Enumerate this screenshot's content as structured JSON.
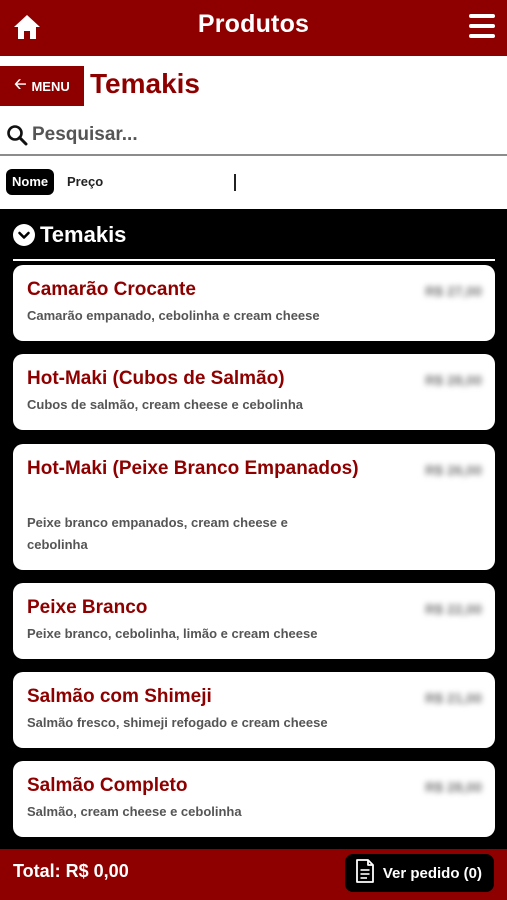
{
  "header": {
    "title": "Produtos",
    "home_icon": "home-icon",
    "menu_icon": "hamburger-menu-icon"
  },
  "nav": {
    "back_label": "MENU",
    "back_icon": "arrow-left-icon",
    "category_title": "Temakis"
  },
  "search": {
    "placeholder": "Pesquisar...",
    "value": ""
  },
  "sort": {
    "active": "Nome",
    "other": "Preço"
  },
  "section": {
    "title": "Temakis",
    "icon": "chevron-down-circle-icon"
  },
  "products": [
    {
      "name": "Camarão Crocante",
      "description": "Camarão empanado, cebolinha e cream cheese",
      "price": "R$ 27,00"
    },
    {
      "name": "Hot-Maki (Cubos de Salmão)",
      "description": "Cubos de salmão, cream cheese e cebolinha",
      "price": "R$ 28,00"
    },
    {
      "name": "Hot-Maki (Peixe Branco Empanados)",
      "description": "Peixe branco empanados, cream cheese e cebolinha",
      "price": "R$ 26,00"
    },
    {
      "name": "Peixe Branco",
      "description": "Peixe branco, cebolinha, limão e cream cheese",
      "price": "R$ 22,00"
    },
    {
      "name": "Salmão com Shimeji",
      "description": "Salmão fresco, shimeji refogado e cream cheese",
      "price": "R$ 21,00"
    },
    {
      "name": "Salmão Completo",
      "description": "Salmão, cream cheese e cebolinha",
      "price": "R$ 28,00"
    }
  ],
  "footer": {
    "total_label": "Total: R$ 0,00",
    "order_button": "Ver pedido (0)",
    "order_icon": "document-icon"
  },
  "colors": {
    "brand": "#8e0000",
    "background": "#000000",
    "card": "#ffffff"
  }
}
